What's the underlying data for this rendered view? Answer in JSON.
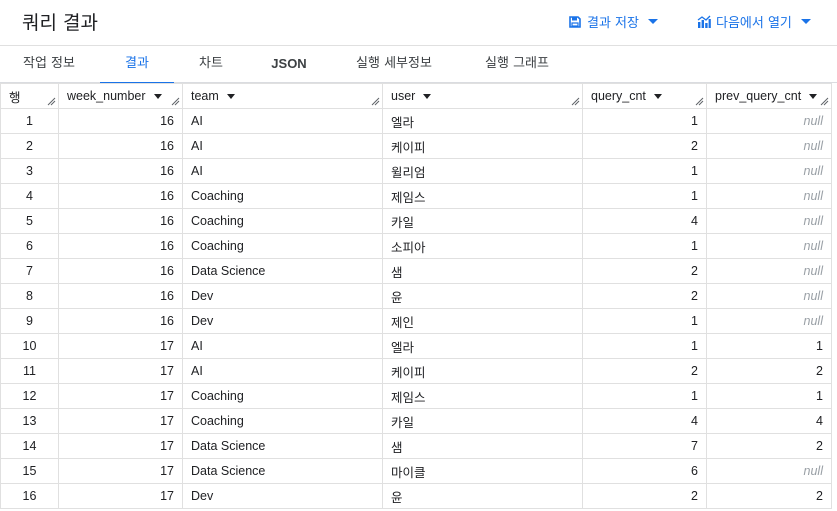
{
  "header": {
    "title": "쿼리 결과",
    "save_label": "결과 저장",
    "open_label": "다음에서 열기"
  },
  "tabs": [
    {
      "label": "작업 정보"
    },
    {
      "label": "결과"
    },
    {
      "label": "차트"
    },
    {
      "label": "JSON"
    },
    {
      "label": "실행 세부정보"
    },
    {
      "label": "실행 그래프"
    }
  ],
  "table": {
    "columns": [
      "행",
      "week_number",
      "team",
      "user",
      "query_cnt",
      "prev_query_cnt"
    ],
    "null_text": "null",
    "rows": [
      [
        "1",
        "16",
        "AI",
        "엘라",
        "1",
        "null"
      ],
      [
        "2",
        "16",
        "AI",
        "케이피",
        "2",
        "null"
      ],
      [
        "3",
        "16",
        "AI",
        "윌리엄",
        "1",
        "null"
      ],
      [
        "4",
        "16",
        "Coaching",
        "제임스",
        "1",
        "null"
      ],
      [
        "5",
        "16",
        "Coaching",
        "카일",
        "4",
        "null"
      ],
      [
        "6",
        "16",
        "Coaching",
        "소피아",
        "1",
        "null"
      ],
      [
        "7",
        "16",
        "Data Science",
        "샘",
        "2",
        "null"
      ],
      [
        "8",
        "16",
        "Dev",
        "윤",
        "2",
        "null"
      ],
      [
        "9",
        "16",
        "Dev",
        "제인",
        "1",
        "null"
      ],
      [
        "10",
        "17",
        "AI",
        "엘라",
        "1",
        "1"
      ],
      [
        "11",
        "17",
        "AI",
        "케이피",
        "2",
        "2"
      ],
      [
        "12",
        "17",
        "Coaching",
        "제임스",
        "1",
        "1"
      ],
      [
        "13",
        "17",
        "Coaching",
        "카일",
        "4",
        "4"
      ],
      [
        "14",
        "17",
        "Data Science",
        "샘",
        "7",
        "2"
      ],
      [
        "15",
        "17",
        "Data Science",
        "마이클",
        "6",
        "null"
      ],
      [
        "16",
        "17",
        "Dev",
        "윤",
        "2",
        "2"
      ]
    ]
  },
  "colors": {
    "accent": "#1a73e8",
    "null_text": "#9aa0a6",
    "border": "#e0e0e0"
  }
}
